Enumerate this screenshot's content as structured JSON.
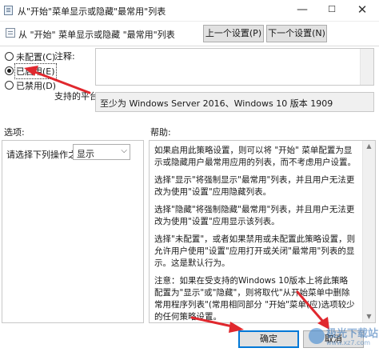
{
  "window": {
    "title": "从\"开始\"菜单显示或隐藏\"最常用\"列表",
    "controls": {
      "minimize": "—",
      "maximize": "☐",
      "close": "✕"
    }
  },
  "header": {
    "setting_name": "从 \"开始\" 菜单显示或隐藏 \"最常用\"列表",
    "prev_label": "上一个设置(P)",
    "next_label": "下一个设置(N)"
  },
  "state": {
    "options": [
      {
        "label": "未配置(C)",
        "checked": false
      },
      {
        "label": "已启用(E)",
        "checked": true
      },
      {
        "label": "已禁用(D)",
        "checked": false
      }
    ]
  },
  "comment": {
    "label": "注释:",
    "value": ""
  },
  "supported": {
    "label": "支持的平台:",
    "value": "至少为 Windows Server 2016、Windows 10 版本 1909"
  },
  "options_section": {
    "title": "选项:",
    "field_label": "请选择下列操作之一",
    "select_value": "显示"
  },
  "help_section": {
    "title": "帮助:",
    "paragraphs": [
      "如果启用此策略设置，则可以将 \"开始\" 菜单配置为显示或隐藏用户最常用应用的列表，而不考虑用户设置。",
      "选择\"显示\"将强制显示\"最常用\"列表，并且用户无法更改为使用\"设置\"应用隐藏列表。",
      "选择\"隐藏\"将强制隐藏\"最常用\"列表，并且用户无法更改为使用\"设置\"应用显示该列表。",
      "选择\"未配置\"，或者如果禁用或未配置此策略设置，则允许用户使用\"设置\"应用打开或关闭\"最常用\"列表的显示。这是默认行为。",
      "注意：如果在受支持的Windows 10版本上将此策略配置为\"显示\"或\"隐藏\"，则将取代\"从开始菜单中删除常用程序列表\"(常用相同部分 \"开始\"菜单(应)选项较少的任何策略设置。"
    ]
  },
  "footer": {
    "ok_label": "确定",
    "cancel_label": "取消"
  },
  "watermark": {
    "text": "极光下载站",
    "url": "www.xz7.com"
  },
  "colors": {
    "annotation_arrow": "#e0282e",
    "default_button_border": "#0078d7"
  }
}
